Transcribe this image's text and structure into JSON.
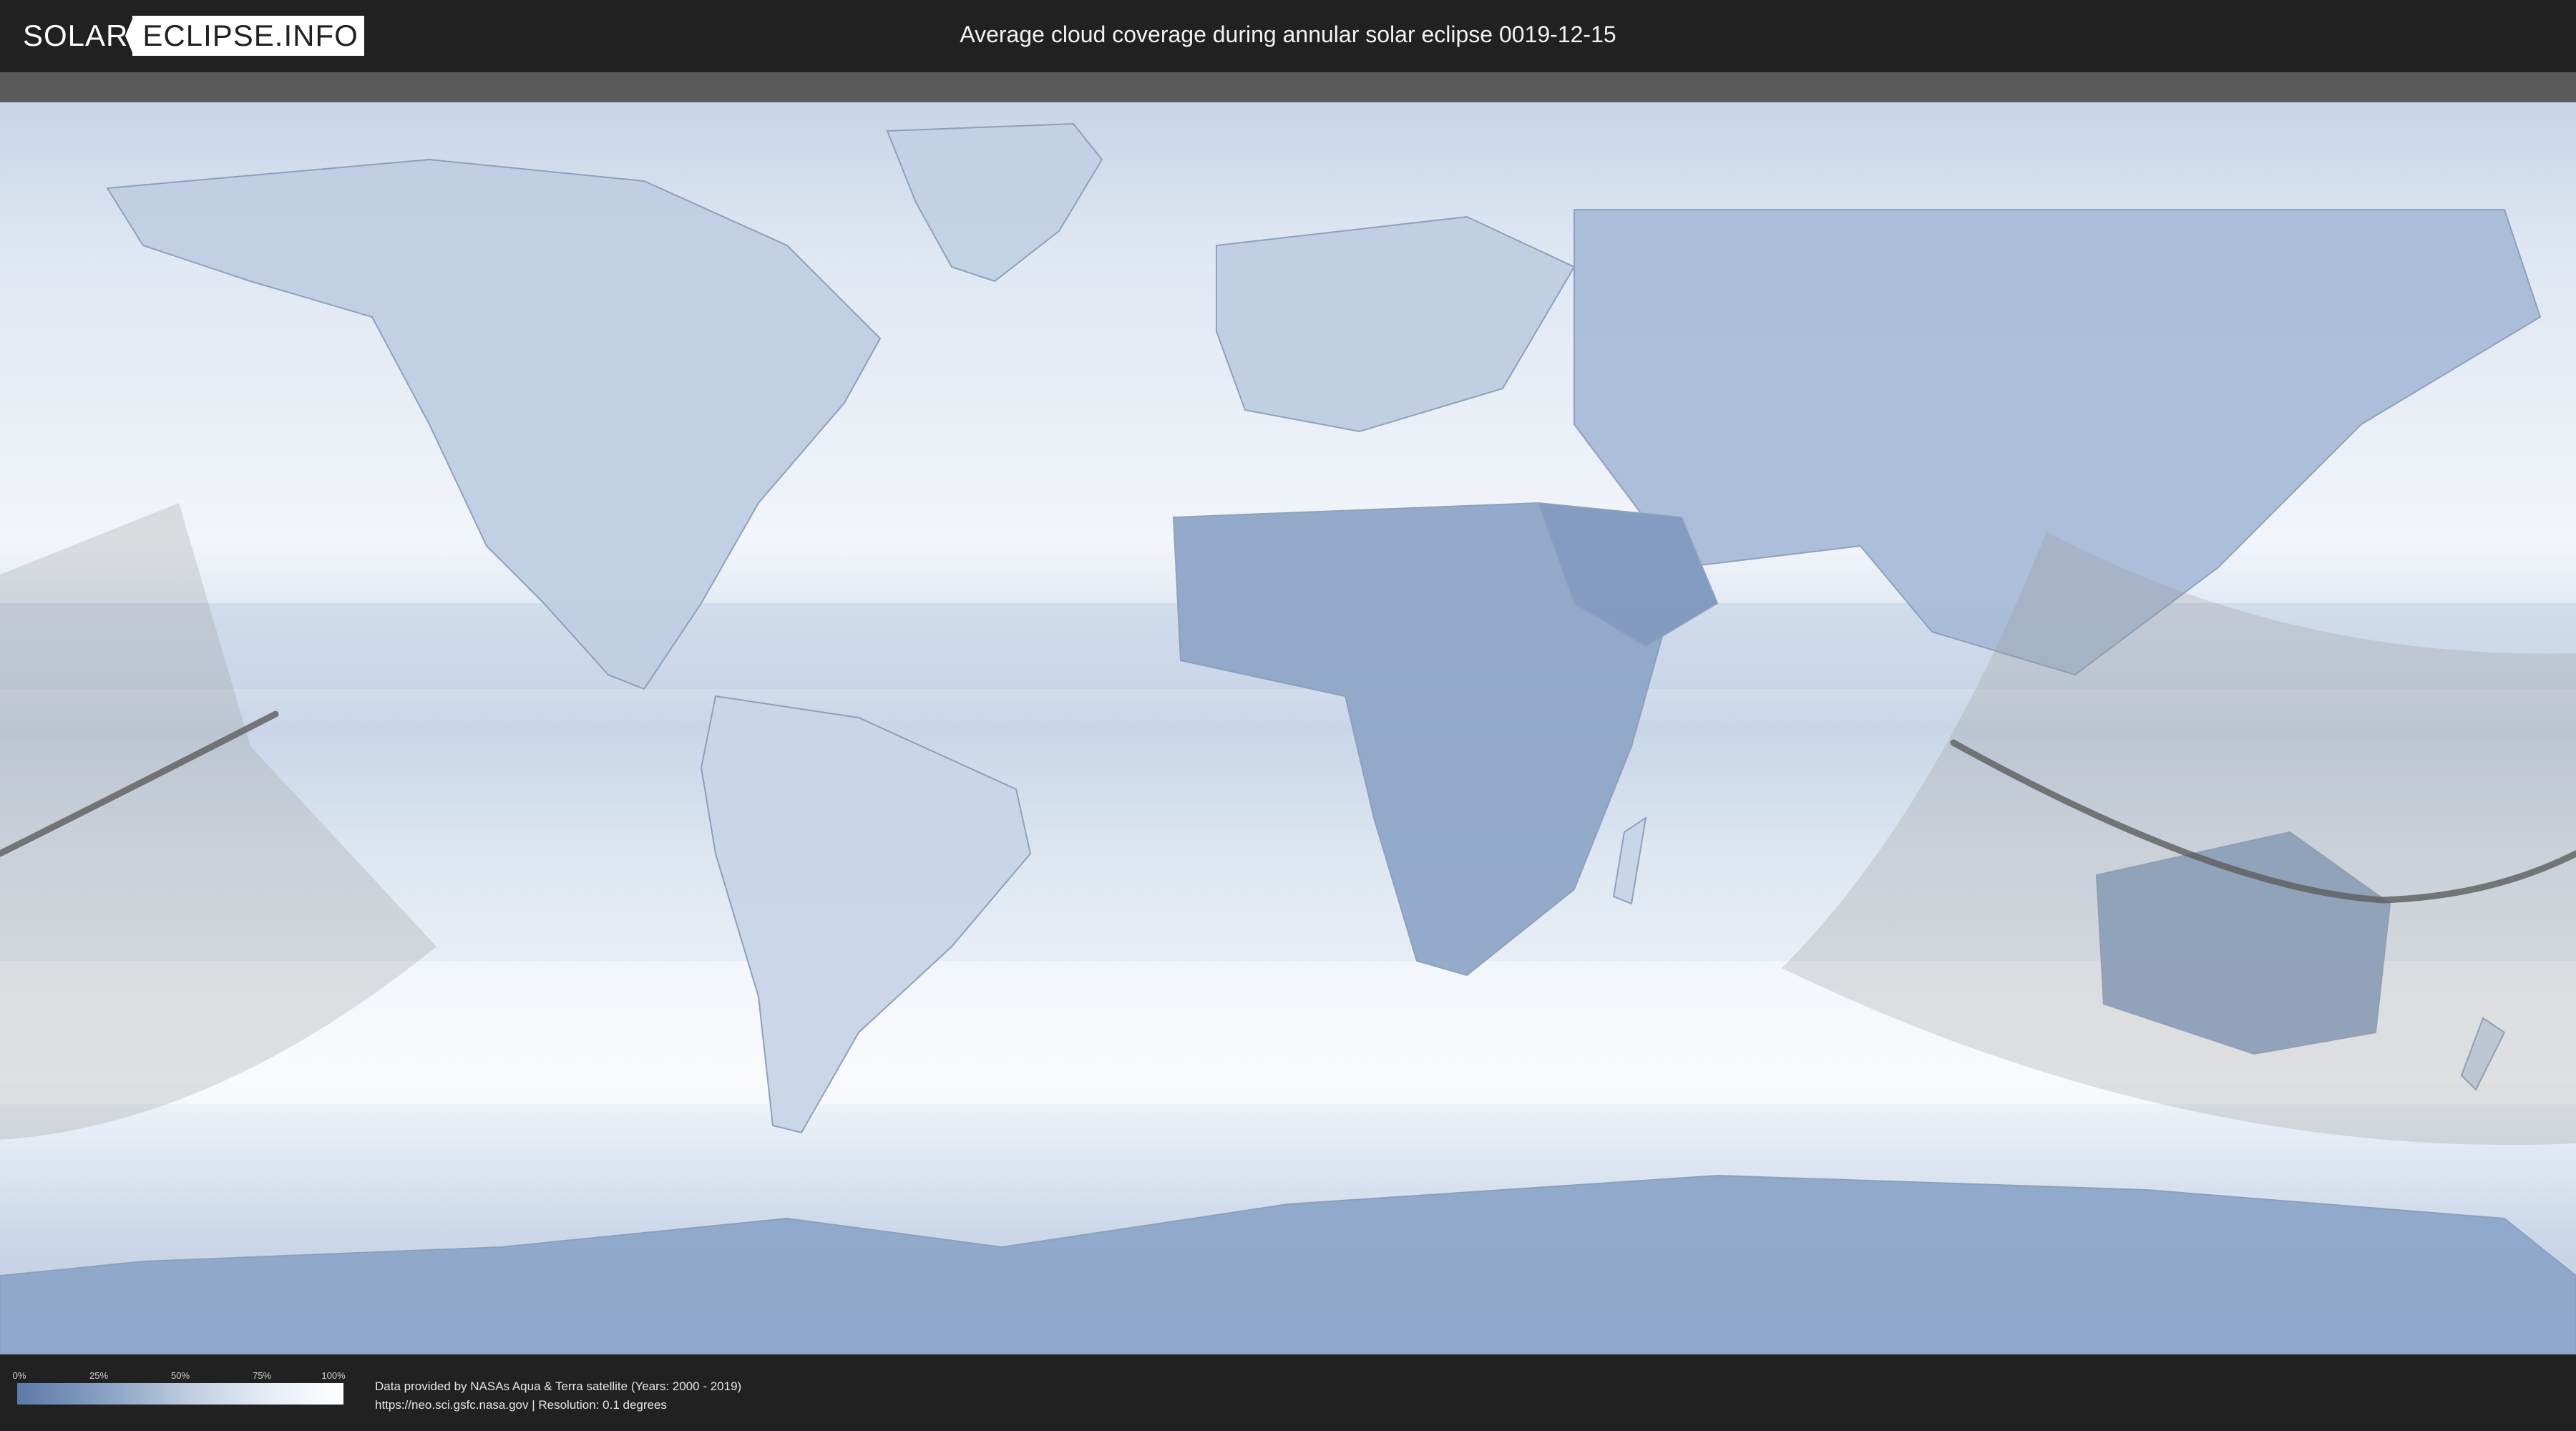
{
  "header": {
    "logo_left": "SOLAR",
    "logo_right": "ECLIPSE.INFO",
    "title": "Average cloud coverage during annular solar eclipse 0019-12-15"
  },
  "legend": {
    "ticks": [
      "0%",
      "25%",
      "50%",
      "75%",
      "100%"
    ],
    "color_low": "#5b7aa6",
    "color_high": "#ffffff"
  },
  "footer": {
    "credit_line1": "Data provided by NASAs Aqua & Terra satellite (Years: 2000 - 2019)",
    "credit_line2": "https://neo.sci.gsfc.nasa.gov | Resolution: 0.1 degrees"
  },
  "map": {
    "projection": "equirectangular",
    "ocean_color": "#e9eff7",
    "land_cloud_color": "#b8c8df",
    "eclipse_zone_color": "#9a9a9a",
    "central_line_color": "#5c5c5c"
  }
}
